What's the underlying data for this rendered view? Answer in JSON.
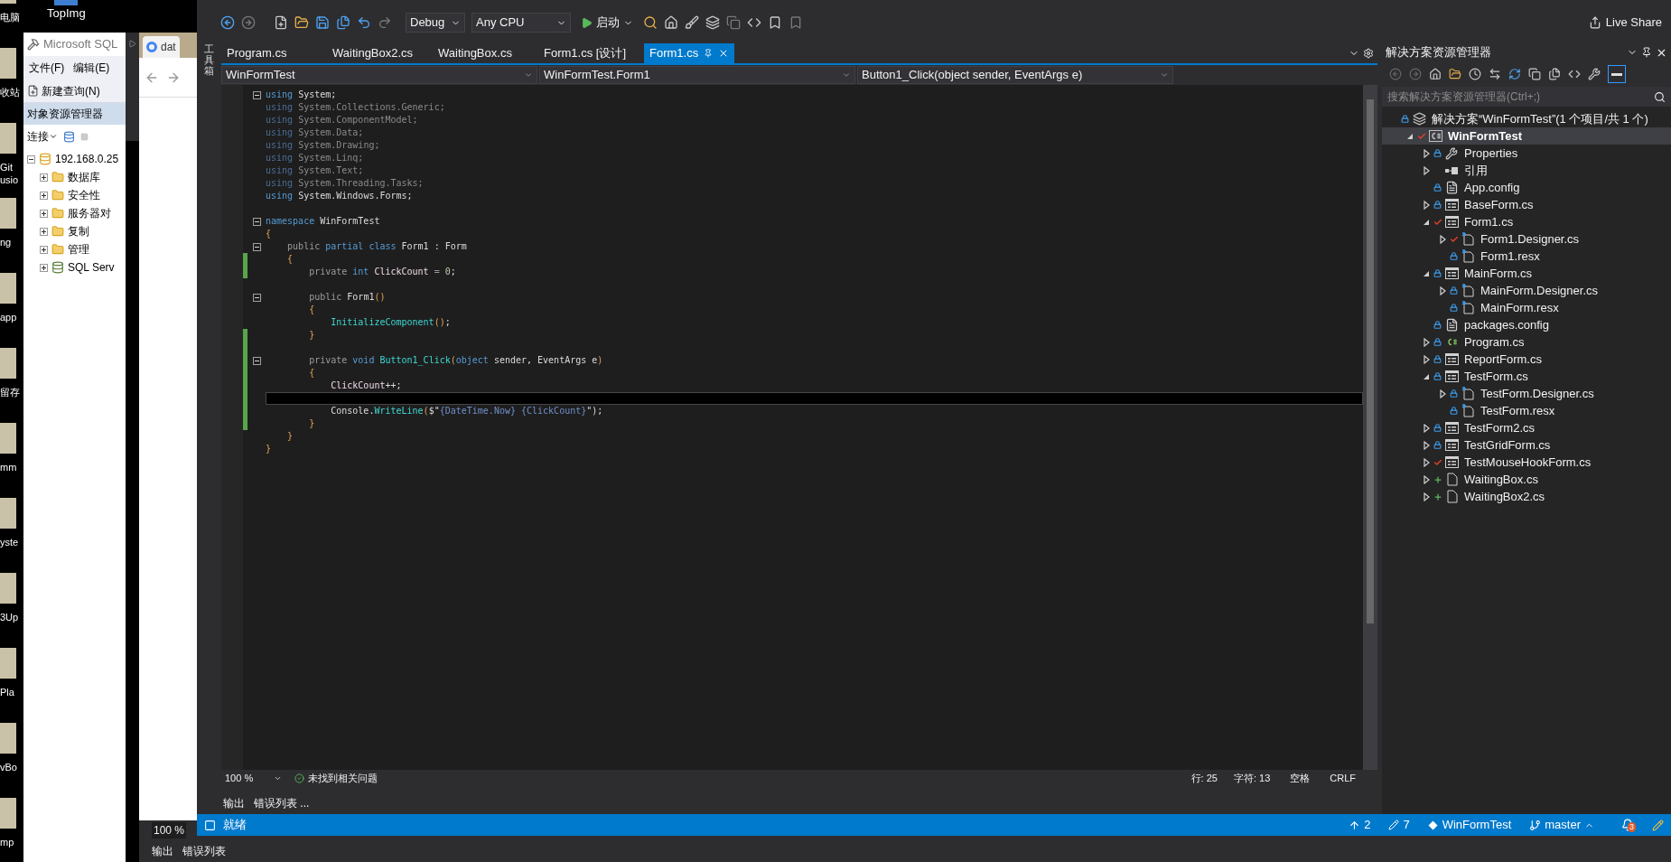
{
  "desktop": {
    "icons": [
      {
        "label": "电脑"
      },
      {
        "label": "收站"
      },
      {
        "label": "Git usio"
      },
      {
        "label": "ng"
      },
      {
        "label": "app"
      },
      {
        "label": "留存"
      },
      {
        "label": "mm"
      },
      {
        "label": "yste"
      },
      {
        "label": "3Up"
      },
      {
        "label": "Pla"
      },
      {
        "label": "vBo"
      },
      {
        "label": "mp"
      }
    ],
    "top_icon": {
      "label": "TopImg"
    }
  },
  "ssms": {
    "title": "Microsoft SQL",
    "menu": [
      "文件(F)",
      "编辑(E)"
    ],
    "new_query": "新建查询(N)",
    "explorer_title": "对象资源管理器",
    "connect": "连接",
    "tree": {
      "label": "192.168.0.25",
      "expanded": true,
      "children": [
        {
          "label": "数据库",
          "kind": "folder",
          "expanded": false
        },
        {
          "label": "安全性",
          "kind": "folder",
          "expanded": false
        },
        {
          "label": "服务器对",
          "kind": "folder",
          "expanded": false
        },
        {
          "label": "复制",
          "kind": "folder",
          "expanded": false
        },
        {
          "label": "管理",
          "kind": "folder",
          "expanded": false
        },
        {
          "label": "SQL Serv",
          "kind": "agent",
          "expanded": false
        }
      ]
    }
  },
  "browser": {
    "tab": "dat"
  },
  "background_ide": {
    "zoom": "100 %",
    "tabs": [
      "输出",
      "错误列表"
    ]
  },
  "ide": {
    "toolbar": {
      "configuration": "Debug",
      "platform": "Any CPU",
      "start": "启动"
    },
    "live_share": "Live Share",
    "toolbox": "工具箱",
    "tabs": [
      {
        "label": "Program.cs",
        "selected": false
      },
      {
        "label": "WaitingBox2.cs",
        "selected": false
      },
      {
        "label": "WaitingBox.cs",
        "selected": false
      },
      {
        "label": "Form1.cs [设计]",
        "selected": false
      },
      {
        "label": "Form1.cs",
        "selected": true
      }
    ],
    "nav": [
      "WinFormTest",
      "WinFormTest.Form1",
      "Button1_Click(object sender, EventArgs e)"
    ],
    "code": [
      {
        "fold": true,
        "changed": false,
        "current": false,
        "tokens": [
          {
            "kind": "kw",
            "text": "using"
          },
          {
            "kind": "plain",
            "text": " System;"
          }
        ]
      },
      {
        "fold": false,
        "changed": false,
        "current": false,
        "tokens": [
          {
            "kind": "kw_dim",
            "text": "using"
          },
          {
            "kind": "plain_dim",
            "text": " System.Collections.Generic;"
          }
        ]
      },
      {
        "fold": false,
        "changed": false,
        "current": false,
        "tokens": [
          {
            "kind": "kw_dim",
            "text": "using"
          },
          {
            "kind": "plain_dim",
            "text": " System.ComponentModel;"
          }
        ]
      },
      {
        "fold": false,
        "changed": false,
        "current": false,
        "tokens": [
          {
            "kind": "kw_dim",
            "text": "using"
          },
          {
            "kind": "plain_dim",
            "text": " System.Data;"
          }
        ]
      },
      {
        "fold": false,
        "changed": false,
        "current": false,
        "tokens": [
          {
            "kind": "kw_dim",
            "text": "using"
          },
          {
            "kind": "plain_dim",
            "text": " System.Drawing;"
          }
        ]
      },
      {
        "fold": false,
        "changed": false,
        "current": false,
        "tokens": [
          {
            "kind": "kw_dim",
            "text": "using"
          },
          {
            "kind": "plain_dim",
            "text": " System.Linq;"
          }
        ]
      },
      {
        "fold": false,
        "changed": false,
        "current": false,
        "tokens": [
          {
            "kind": "kw_dim",
            "text": "using"
          },
          {
            "kind": "plain_dim",
            "text": " System.Text;"
          }
        ]
      },
      {
        "fold": false,
        "changed": false,
        "current": false,
        "tokens": [
          {
            "kind": "kw_dim",
            "text": "using"
          },
          {
            "kind": "plain_dim",
            "text": " System.Threading.Tasks;"
          }
        ]
      },
      {
        "fold": false,
        "changed": false,
        "current": false,
        "tokens": [
          {
            "kind": "kw",
            "text": "using"
          },
          {
            "kind": "plain",
            "text": " System.Windows.Forms;"
          }
        ]
      },
      {
        "fold": false,
        "changed": false,
        "current": false
      },
      {
        "fold": true,
        "changed": false,
        "current": false,
        "tokens": [
          {
            "kind": "kw",
            "text": "namespace"
          },
          {
            "kind": "plain",
            "text": " WinFormTest"
          }
        ]
      },
      {
        "fold": false,
        "changed": false,
        "current": false,
        "tokens": [
          {
            "kind": "brace",
            "text": "{"
          }
        ]
      },
      {
        "fold": true,
        "changed": false,
        "current": false,
        "tokens": [
          {
            "kind": "mod",
            "text": "    public"
          },
          {
            "kind": "kw",
            "text": " partial class"
          },
          {
            "kind": "plain",
            "text": " Form1 : Form"
          }
        ]
      },
      {
        "fold": false,
        "changed": true,
        "current": false,
        "tokens": [
          {
            "kind": "brace",
            "text": "    {"
          }
        ]
      },
      {
        "fold": false,
        "changed": true,
        "current": false,
        "tokens": [
          {
            "kind": "mod",
            "text": "        private"
          },
          {
            "kind": "kw",
            "text": " int"
          },
          {
            "kind": "field",
            "text": " ClickCount"
          },
          {
            "kind": "mod",
            "text": " = "
          },
          {
            "kind": "num",
            "text": "0"
          },
          {
            "kind": "plain",
            "text": ";"
          }
        ]
      },
      {
        "fold": false,
        "changed": false,
        "current": false
      },
      {
        "fold": true,
        "changed": false,
        "current": false,
        "tokens": [
          {
            "kind": "mod",
            "text": "        public"
          },
          {
            "kind": "plain",
            "text": " Form1"
          },
          {
            "kind": "brace",
            "text": "()"
          }
        ]
      },
      {
        "fold": false,
        "changed": false,
        "current": false,
        "tokens": [
          {
            "kind": "brace",
            "text": "        {"
          }
        ]
      },
      {
        "fold": false,
        "changed": false,
        "current": false,
        "tokens": [
          {
            "kind": "method",
            "text": "            InitializeComponent"
          },
          {
            "kind": "brace",
            "text": "()"
          },
          {
            "kind": "plain",
            "text": ";"
          }
        ]
      },
      {
        "fold": false,
        "changed": true,
        "current": false,
        "tokens": [
          {
            "kind": "brace",
            "text": "        }"
          }
        ]
      },
      {
        "fold": false,
        "changed": true,
        "current": false
      },
      {
        "fold": true,
        "changed": true,
        "current": false,
        "tokens": [
          {
            "kind": "mod",
            "text": "        private"
          },
          {
            "kind": "kw",
            "text": " void"
          },
          {
            "kind": "method",
            "text": " Button1_Click"
          },
          {
            "kind": "brace",
            "text": "("
          },
          {
            "kind": "kw",
            "text": "object"
          },
          {
            "kind": "plain",
            "text": " sender, EventArgs e"
          },
          {
            "kind": "brace",
            "text": ")"
          }
        ]
      },
      {
        "fold": false,
        "changed": true,
        "current": false,
        "tokens": [
          {
            "kind": "brace",
            "text": "        {"
          }
        ]
      },
      {
        "fold": false,
        "changed": true,
        "current": false,
        "tokens": [
          {
            "kind": "field",
            "text": "            ClickCount"
          },
          {
            "kind": "plain",
            "text": "++;"
          }
        ]
      },
      {
        "fold": false,
        "changed": true,
        "current": true
      },
      {
        "fold": false,
        "changed": true,
        "current": false,
        "tokens": [
          {
            "kind": "plain",
            "text": "            Console."
          },
          {
            "kind": "method",
            "text": "WriteLine"
          },
          {
            "kind": "brace",
            "text": "("
          },
          {
            "kind": "plain",
            "text": "$\""
          },
          {
            "kind": "interp",
            "text": "{DateTime.Now} {ClickCount}"
          },
          {
            "kind": "plain",
            "text": "\");"
          }
        ]
      },
      {
        "fold": false,
        "changed": true,
        "current": false,
        "tokens": [
          {
            "kind": "brace",
            "text": "        }"
          }
        ]
      },
      {
        "fold": false,
        "changed": false,
        "current": false,
        "tokens": [
          {
            "kind": "brace",
            "text": "    }"
          }
        ]
      },
      {
        "fold": false,
        "changed": false,
        "current": false,
        "tokens": [
          {
            "kind": "brace",
            "text": "}"
          }
        ]
      }
    ],
    "editor_status": {
      "zoom": "100 %",
      "issues": "未找到相关问题",
      "line": "行: 25",
      "column": "字符: 13",
      "indent": "空格",
      "eol": "CRLF"
    },
    "panel_tabs": [
      "输出",
      "错误列表 ..."
    ],
    "status_bar": {
      "state": "就绪",
      "pushes": "2",
      "changes": "7",
      "repository": "WinFormTest",
      "branch": "master",
      "notifications": "3"
    }
  },
  "solution_explorer": {
    "title": "解决方案资源管理器",
    "search": {
      "placeholder": "搜索解决方案资源管理器(Ctrl+;)"
    },
    "tree": [
      {
        "label": "解决方案“WinFormTest”(1 个项目/共 1 个)",
        "kind": "solution",
        "locked": true,
        "checked_out": false,
        "added": false,
        "selected": false,
        "children": [
          {
            "label": "WinFormTest",
            "kind": "project",
            "locked": false,
            "checked_out": true,
            "added": false,
            "expanded": true,
            "selected": true,
            "children": [
              {
                "label": "Properties",
                "kind": "wrench",
                "locked": true,
                "checked_out": false,
                "added": false,
                "expanded": false,
                "selected": false
              },
              {
                "label": "引用",
                "kind": "references",
                "locked": false,
                "checked_out": false,
                "added": false,
                "expanded": false,
                "selected": false
              },
              {
                "label": "App.config",
                "kind": "config",
                "locked": true,
                "checked_out": false,
                "added": false,
                "selected": false
              },
              {
                "label": "BaseForm.cs",
                "kind": "form",
                "locked": true,
                "checked_out": false,
                "added": false,
                "expanded": false,
                "selected": false
              },
              {
                "label": "Form1.cs",
                "kind": "form",
                "locked": false,
                "checked_out": true,
                "added": false,
                "expanded": true,
                "selected": false,
                "children": [
                  {
                    "label": "Form1.Designer.cs",
                    "kind": "designer",
                    "locked": false,
                    "checked_out": true,
                    "added": false,
                    "expanded": false,
                    "selected": false
                  },
                  {
                    "label": "Form1.resx",
                    "kind": "designer",
                    "locked": true,
                    "checked_out": false,
                    "added": false,
                    "selected": false
                  }
                ]
              },
              {
                "label": "MainForm.cs",
                "kind": "form",
                "locked": true,
                "checked_out": false,
                "added": false,
                "expanded": true,
                "selected": false,
                "children": [
                  {
                    "label": "MainForm.Designer.cs",
                    "kind": "designer",
                    "locked": true,
                    "checked_out": false,
                    "added": false,
                    "expanded": false,
                    "selected": false
                  },
                  {
                    "label": "MainForm.resx",
                    "kind": "designer",
                    "locked": true,
                    "checked_out": false,
                    "added": false,
                    "selected": false
                  }
                ]
              },
              {
                "label": "packages.config",
                "kind": "config",
                "locked": true,
                "checked_out": false,
                "added": false,
                "selected": false
              },
              {
                "label": "Program.cs",
                "kind": "csharp",
                "locked": true,
                "checked_out": false,
                "added": false,
                "expanded": false,
                "selected": false
              },
              {
                "label": "ReportForm.cs",
                "kind": "form",
                "locked": true,
                "checked_out": false,
                "added": false,
                "expanded": false,
                "selected": false
              },
              {
                "label": "TestForm.cs",
                "kind": "form",
                "locked": true,
                "checked_out": false,
                "added": false,
                "expanded": true,
                "selected": false,
                "children": [
                  {
                    "label": "TestForm.Designer.cs",
                    "kind": "designer",
                    "locked": true,
                    "checked_out": false,
                    "added": false,
                    "expanded": false,
                    "selected": false
                  },
                  {
                    "label": "TestForm.resx",
                    "kind": "designer",
                    "locked": true,
                    "checked_out": false,
                    "added": false,
                    "selected": false
                  }
                ]
              },
              {
                "label": "TestForm2.cs",
                "kind": "form",
                "locked": true,
                "checked_out": false,
                "added": false,
                "expanded": false,
                "selected": false
              },
              {
                "label": "TestGridForm.cs",
                "kind": "form",
                "locked": true,
                "checked_out": false,
                "added": false,
                "expanded": false,
                "selected": false
              },
              {
                "label": "TestMouseHookForm.cs",
                "kind": "form",
                "locked": false,
                "checked_out": true,
                "added": false,
                "expanded": false,
                "selected": false
              },
              {
                "label": "WaitingBox.cs",
                "kind": "file",
                "locked": false,
                "checked_out": false,
                "added": true,
                "expanded": false,
                "selected": false
              },
              {
                "label": "WaitingBox2.cs",
                "kind": "file",
                "locked": false,
                "checked_out": false,
                "added": true,
                "expanded": false,
                "selected": false
              }
            ]
          }
        ]
      }
    ]
  }
}
